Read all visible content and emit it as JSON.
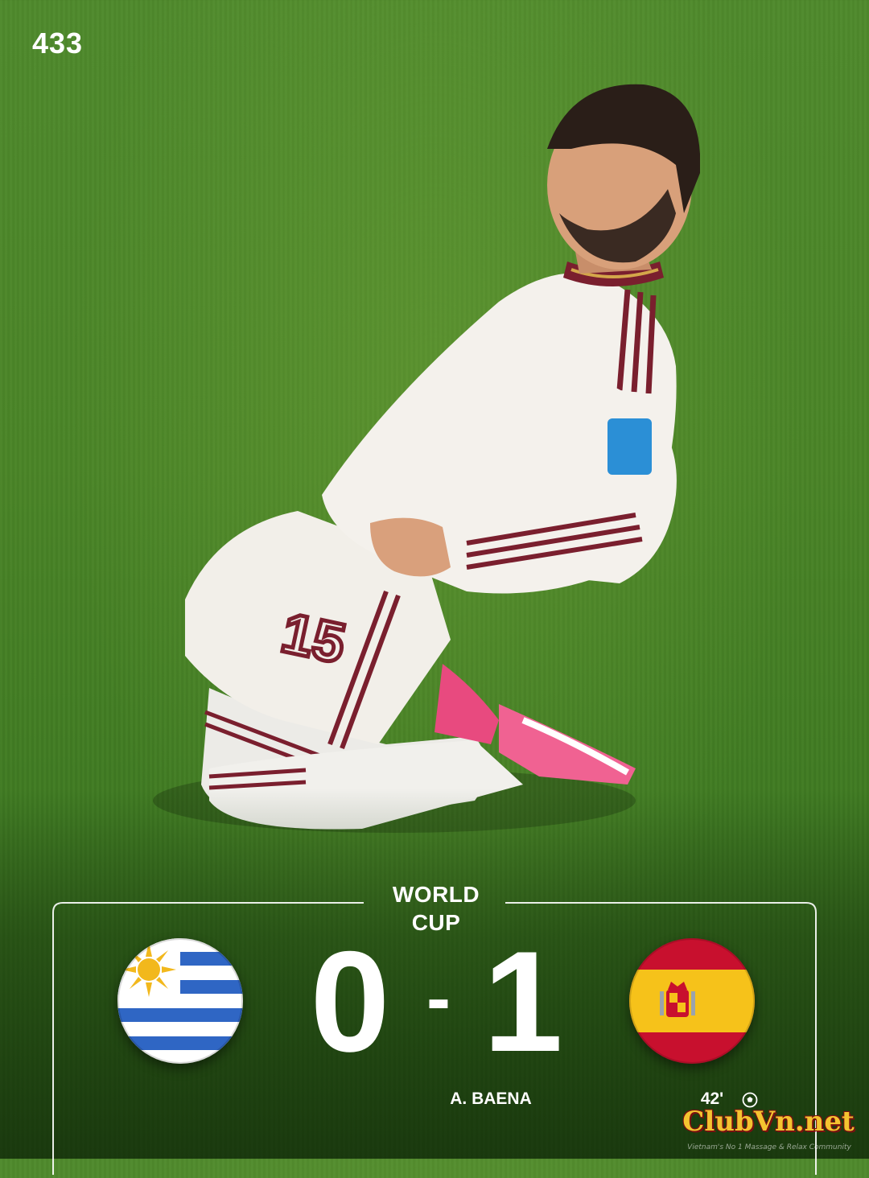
{
  "brand": {
    "logo_text": "433"
  },
  "match": {
    "competition_line1": "WORLD",
    "competition_line2": "CUP",
    "home_team": {
      "flag_icon": "uruguay-flag-icon",
      "score": "0"
    },
    "away_team": {
      "flag_icon": "spain-flag-icon",
      "score": "1"
    },
    "separator": "-",
    "scorer": "A. BAENA",
    "goal_minute": "42'",
    "goal_icon": "soccer-ball-icon"
  },
  "watermark": {
    "text": "ClubVn.net",
    "tagline": "Vietnam's No 1 Massage & Relax Community"
  },
  "colors": {
    "pitch": "#4a8527",
    "kit_primary": "#f2efe9",
    "kit_trim": "#7a1f2e",
    "watermark_fill": "#f4c430",
    "watermark_outline": "#7a1010"
  }
}
